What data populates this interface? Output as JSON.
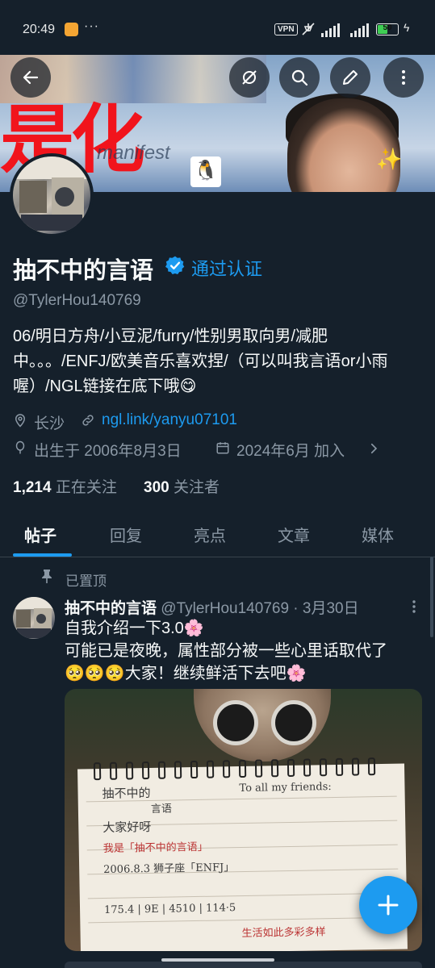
{
  "status_bar": {
    "time": "20:49",
    "dots": "···",
    "vpn": "VPN",
    "battery": "50"
  },
  "banner": {
    "big_text": "是化",
    "caption": "manifest",
    "sparkle": "✨",
    "qq_icon": "penguin-icon"
  },
  "profile": {
    "name": "抽不中的言语",
    "verified_label": "通过认证",
    "handle": "@TylerHou140769",
    "bio": "06/明日方舟/小豆泥/furry/性别男取向男/减肥中。。。/ENFJ/欧美音乐喜欢捏/（可以叫我言语or小雨喔）/NGL链接在底下哦😋",
    "location": "长沙",
    "link": "ngl.link/yanyu07101",
    "birth": "出生于 2006年8月3日",
    "joined": "2024年6月 加入",
    "following_count": "1,214",
    "following_label": "正在关注",
    "followers_count": "300",
    "followers_label": "关注者"
  },
  "tabs": [
    {
      "label": "帖子"
    },
    {
      "label": "回复"
    },
    {
      "label": "亮点"
    },
    {
      "label": "文章"
    },
    {
      "label": "媒体"
    }
  ],
  "post": {
    "pinned_label": "已置顶",
    "author_name": "抽不中的言语",
    "author_handle": "@TylerHou140769",
    "separator": "·",
    "date": "3月30日",
    "line1": "自我介绍一下3.0🌸",
    "line2": "可能已是夜晚，属性部分被一些心里话取代了",
    "line3": "🥺🥺🥺大家！继续鲜活下去吧🌸"
  },
  "notebook": {
    "title": "抽不中的",
    "subtitle": "言语",
    "line_a": "大家好呀",
    "line_b": "我是「抽不中的言语」",
    "line_c": "2006.8.3 狮子座「ENFJ」",
    "line_d": "175.4 | 9E | 4510 | 114·5",
    "line_e": "To all my friends:",
    "line_f": "生活如此多彩多样"
  },
  "colors": {
    "background": "#15202b",
    "accent": "#1d9bf0",
    "muted": "#8b98a5",
    "text": "#f7f9f9"
  }
}
